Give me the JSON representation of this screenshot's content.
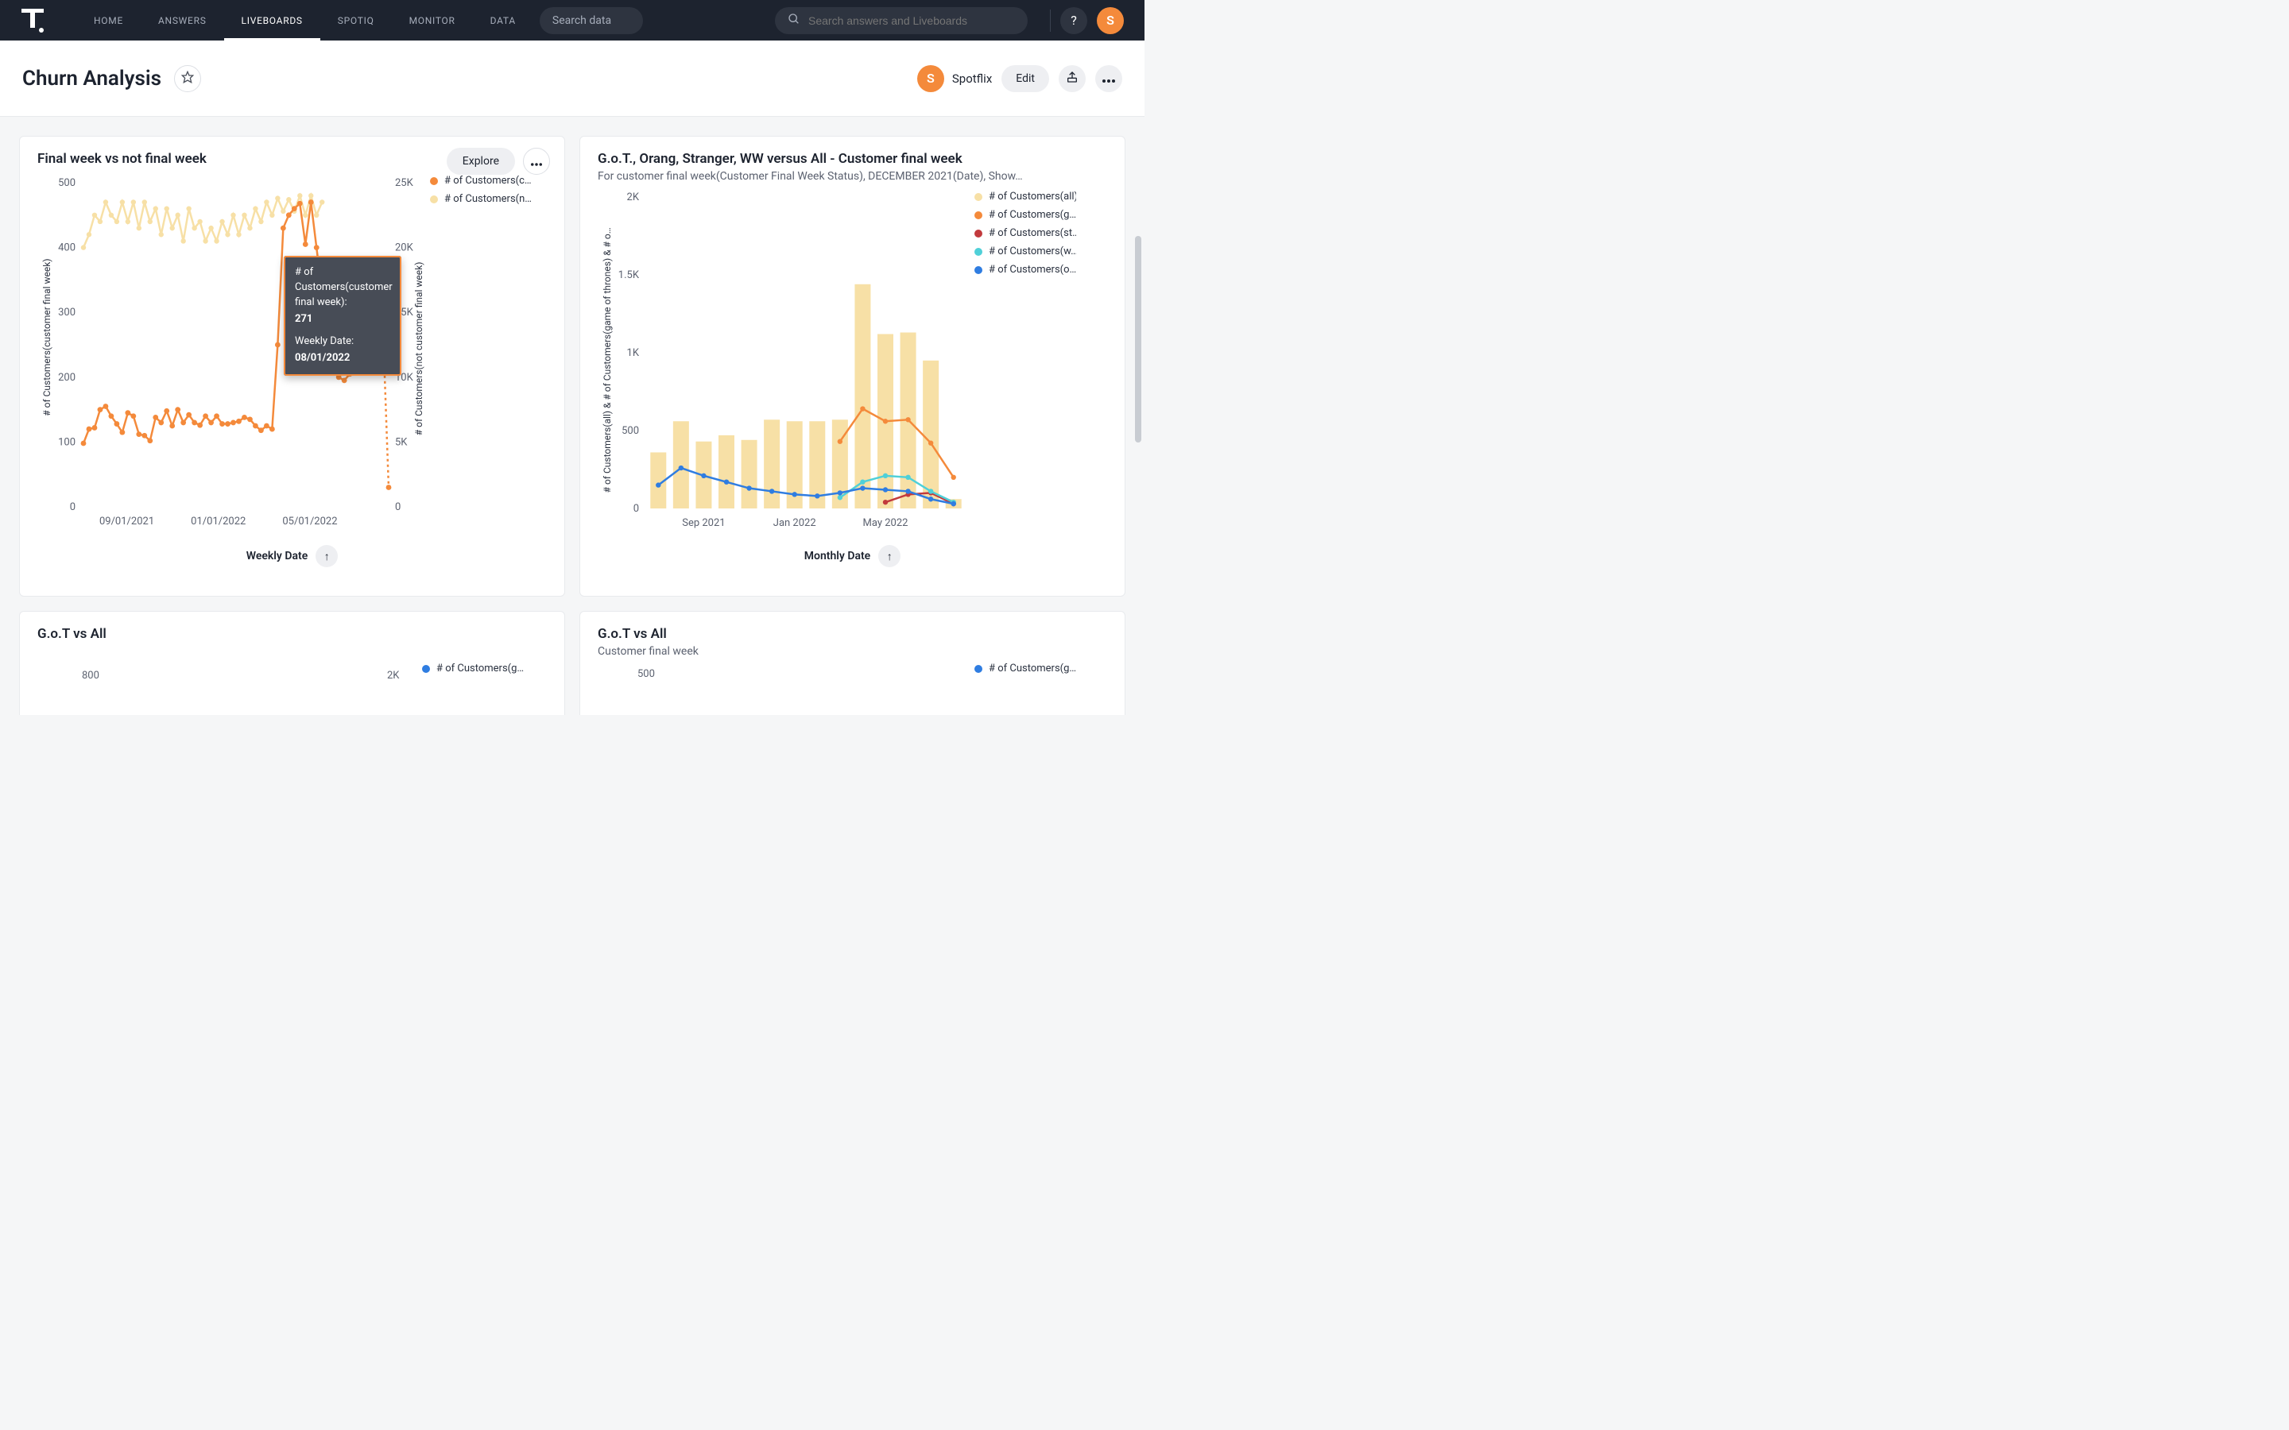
{
  "nav": {
    "items": [
      "HOME",
      "ANSWERS",
      "LIVEBOARDS",
      "SPOTIQ",
      "MONITOR",
      "DATA"
    ],
    "active_index": 2,
    "search_data": "Search data",
    "search_long_placeholder": "Search answers and Liveboards",
    "avatar_letter": "S"
  },
  "header": {
    "title": "Churn Analysis",
    "owner_initial": "S",
    "owner_name": "Spotflix",
    "edit_label": "Edit"
  },
  "cards": {
    "left1": {
      "title": "Final week vs not final week",
      "explore": "Explore",
      "xlabel": "Weekly Date",
      "ylabel_left": "# of Customers(customer final week)",
      "ylabel_right": "# of Customers(not customer final week)",
      "legend": [
        "# of Customers(c…",
        "# of Customers(n…"
      ],
      "tooltip": {
        "metric_label": "# of Customers(customer final week):",
        "metric_value": "271",
        "date_label": "Weekly Date:",
        "date_value": "08/01/2022"
      }
    },
    "right1": {
      "title": "G.o.T., Orang, Stranger, WW versus All - Customer final week",
      "subtitle": "For customer final week(Customer Final Week Status), DECEMBER 2021(Date), Show…",
      "xlabel": "Monthly Date",
      "ylabel": "# of Customers(all) & # of Customers(game of thrones) & # o…",
      "legend": [
        "# of Customers(all)",
        "# of Customers(g…",
        "# of Customers(st…",
        "# of Customers(w…",
        "# of Customers(o…"
      ]
    },
    "left2": {
      "title": "G.o.T vs All",
      "legend": [
        "# of Customers(g…"
      ]
    },
    "right2": {
      "title": "G.o.T vs All",
      "subtitle": "Customer final week",
      "legend": [
        "# of Customers(g…"
      ]
    }
  },
  "colors": {
    "orange": "#f48a3b",
    "cream": "#f7e0a6",
    "red": "#c23a3d",
    "teal": "#4fd0d8",
    "blue": "#2f7de1",
    "axis": "#9aa0aa",
    "grid": "#e9ebef"
  },
  "chart_data": [
    {
      "id": "left1",
      "type": "line-dual-axis",
      "title": "Final week vs not final week",
      "xlabel": "Weekly Date",
      "ylabel_left": "# of Customers(customer final week)",
      "ylabel_right": "# of Customers(not customer final week)",
      "x_ticks": [
        "09/01/2021",
        "01/01/2022",
        "05/01/2022"
      ],
      "y_left_ticks": [
        0,
        100,
        200,
        300,
        400,
        500
      ],
      "y_right_ticks": [
        0,
        "5K",
        "10K",
        "15K",
        "20K",
        "25K"
      ],
      "ylim_left": [
        0,
        500
      ],
      "ylim_right": [
        0,
        25000
      ],
      "series": [
        {
          "name": "# of Customers(customer final week)",
          "axis": "left",
          "color": "#f48a3b",
          "x": [
            "07/25/2021",
            "08/01/2021",
            "08/08/2021",
            "08/15/2021",
            "08/22/2021",
            "08/29/2021",
            "09/05/2021",
            "09/12/2021",
            "09/19/2021",
            "09/26/2021",
            "10/03/2021",
            "10/10/2021",
            "10/17/2021",
            "10/24/2021",
            "10/31/2021",
            "11/07/2021",
            "11/14/2021",
            "11/21/2021",
            "11/28/2021",
            "12/05/2021",
            "12/12/2021",
            "12/19/2021",
            "12/26/2021",
            "01/02/2022",
            "01/09/2022",
            "01/16/2022",
            "01/23/2022",
            "01/30/2022",
            "02/06/2022",
            "02/13/2022",
            "02/20/2022",
            "02/27/2022",
            "03/06/2022",
            "03/13/2022",
            "03/20/2022",
            "03/27/2022",
            "04/03/2022",
            "04/10/2022",
            "04/17/2022",
            "04/24/2022",
            "05/01/2022",
            "05/08/2022",
            "05/15/2022",
            "05/22/2022",
            "05/29/2022",
            "06/05/2022",
            "06/12/2022",
            "06/19/2022",
            "06/26/2022",
            "07/03/2022",
            "07/10/2022",
            "07/17/2022",
            "07/24/2022",
            "07/31/2022",
            "08/01/2022",
            "08/08/2022"
          ],
          "values": [
            98,
            120,
            122,
            150,
            155,
            140,
            128,
            115,
            145,
            140,
            112,
            110,
            102,
            138,
            130,
            148,
            125,
            150,
            130,
            142,
            130,
            126,
            140,
            130,
            140,
            128,
            128,
            130,
            132,
            138,
            135,
            125,
            118,
            125,
            120,
            250,
            430,
            450,
            460,
            468,
            405,
            470,
            400,
            330,
            350,
            300,
            200,
            195,
            205,
            260,
            250,
            280,
            260,
            225,
            271,
            30
          ]
        },
        {
          "name": "# of Customers(not customer final week)",
          "axis": "right",
          "color": "#f7e0a6",
          "x": [
            "07/25/2021",
            "08/01/2021",
            "08/08/2021",
            "08/15/2021",
            "08/22/2021",
            "08/29/2021",
            "09/05/2021",
            "09/12/2021",
            "09/19/2021",
            "09/26/2021",
            "10/03/2021",
            "10/10/2021",
            "10/17/2021",
            "10/24/2021",
            "10/31/2021",
            "11/07/2021",
            "11/14/2021",
            "11/21/2021",
            "11/28/2021",
            "12/05/2021",
            "12/12/2021",
            "12/19/2021",
            "12/26/2021",
            "01/02/2022",
            "01/09/2022",
            "01/16/2022",
            "01/23/2022",
            "01/30/2022",
            "02/06/2022",
            "02/13/2022",
            "02/20/2022",
            "02/27/2022",
            "03/06/2022",
            "03/13/2022",
            "03/20/2022",
            "03/27/2022",
            "04/03/2022",
            "04/10/2022",
            "04/17/2022",
            "04/24/2022",
            "05/01/2022",
            "05/08/2022",
            "05/15/2022",
            "05/22/2022"
          ],
          "values": [
            20000,
            21000,
            22500,
            22000,
            23500,
            22500,
            22000,
            23500,
            22000,
            23500,
            21500,
            23500,
            22000,
            23000,
            21000,
            23000,
            21500,
            22500,
            20500,
            23000,
            21500,
            22000,
            20500,
            21500,
            20500,
            22000,
            21000,
            22500,
            21000,
            22500,
            21500,
            23000,
            22000,
            23500,
            22500,
            23800,
            22800,
            23700,
            22800,
            24000,
            22500,
            24000,
            22500,
            23500
          ]
        }
      ],
      "tooltip_point": {
        "series": 0,
        "x": "08/01/2022",
        "value": 271
      }
    },
    {
      "id": "right1",
      "type": "bar+lines",
      "title": "G.o.T., Orang, Stranger, WW versus All - Customer final week",
      "xlabel": "Monthly Date",
      "ylabel": "# of Customers(all) & # of Customers(game of thrones) & # o…",
      "x": [
        "Jul 2021",
        "Aug 2021",
        "Sep 2021",
        "Oct 2021",
        "Nov 2021",
        "Dec 2021",
        "Jan 2022",
        "Feb 2022",
        "Mar 2022",
        "Apr 2022",
        "May 2022",
        "Jun 2022",
        "Jul 2022",
        "Aug 2022"
      ],
      "x_ticks": [
        "Sep 2021",
        "Jan 2022",
        "May 2022"
      ],
      "y_ticks": [
        0,
        500,
        "1K",
        "1.5K",
        "2K"
      ],
      "ylim": [
        0,
        2000
      ],
      "series": [
        {
          "name": "# of Customers(all)",
          "type": "bar",
          "color": "#f7e0a6",
          "values": [
            360,
            560,
            430,
            470,
            440,
            570,
            560,
            560,
            570,
            1440,
            1120,
            1130,
            950,
            60
          ]
        },
        {
          "name": "# of Customers(g…)",
          "type": "line",
          "color": "#f48a3b",
          "values": [
            null,
            null,
            null,
            null,
            null,
            null,
            null,
            null,
            430,
            640,
            560,
            570,
            420,
            200
          ]
        },
        {
          "name": "# of Customers(st…)",
          "type": "line",
          "color": "#c23a3d",
          "values": [
            null,
            null,
            null,
            null,
            null,
            null,
            null,
            null,
            null,
            null,
            40,
            90,
            100,
            30
          ]
        },
        {
          "name": "# of Customers(w…)",
          "type": "line",
          "color": "#4fd0d8",
          "values": [
            null,
            null,
            null,
            null,
            null,
            null,
            null,
            null,
            70,
            170,
            210,
            200,
            110,
            40
          ]
        },
        {
          "name": "# of Customers(o…)",
          "type": "line",
          "color": "#2f7de1",
          "values": [
            150,
            260,
            210,
            170,
            130,
            110,
            90,
            80,
            100,
            130,
            120,
            110,
            60,
            30
          ]
        }
      ]
    },
    {
      "id": "left2",
      "type": "line",
      "title": "G.o.T vs All",
      "y_left_ticks": [
        800
      ],
      "y_right_ticks": [
        "2K"
      ],
      "series": [
        {
          "name": "# of Customers(g…)",
          "color": "#2f7de1"
        }
      ]
    },
    {
      "id": "right2",
      "type": "line",
      "title": "G.o.T vs All",
      "subtitle": "Customer final week",
      "y_left_ticks": [
        500
      ],
      "series": [
        {
          "name": "# of Customers(g…)",
          "color": "#2f7de1"
        }
      ]
    }
  ]
}
